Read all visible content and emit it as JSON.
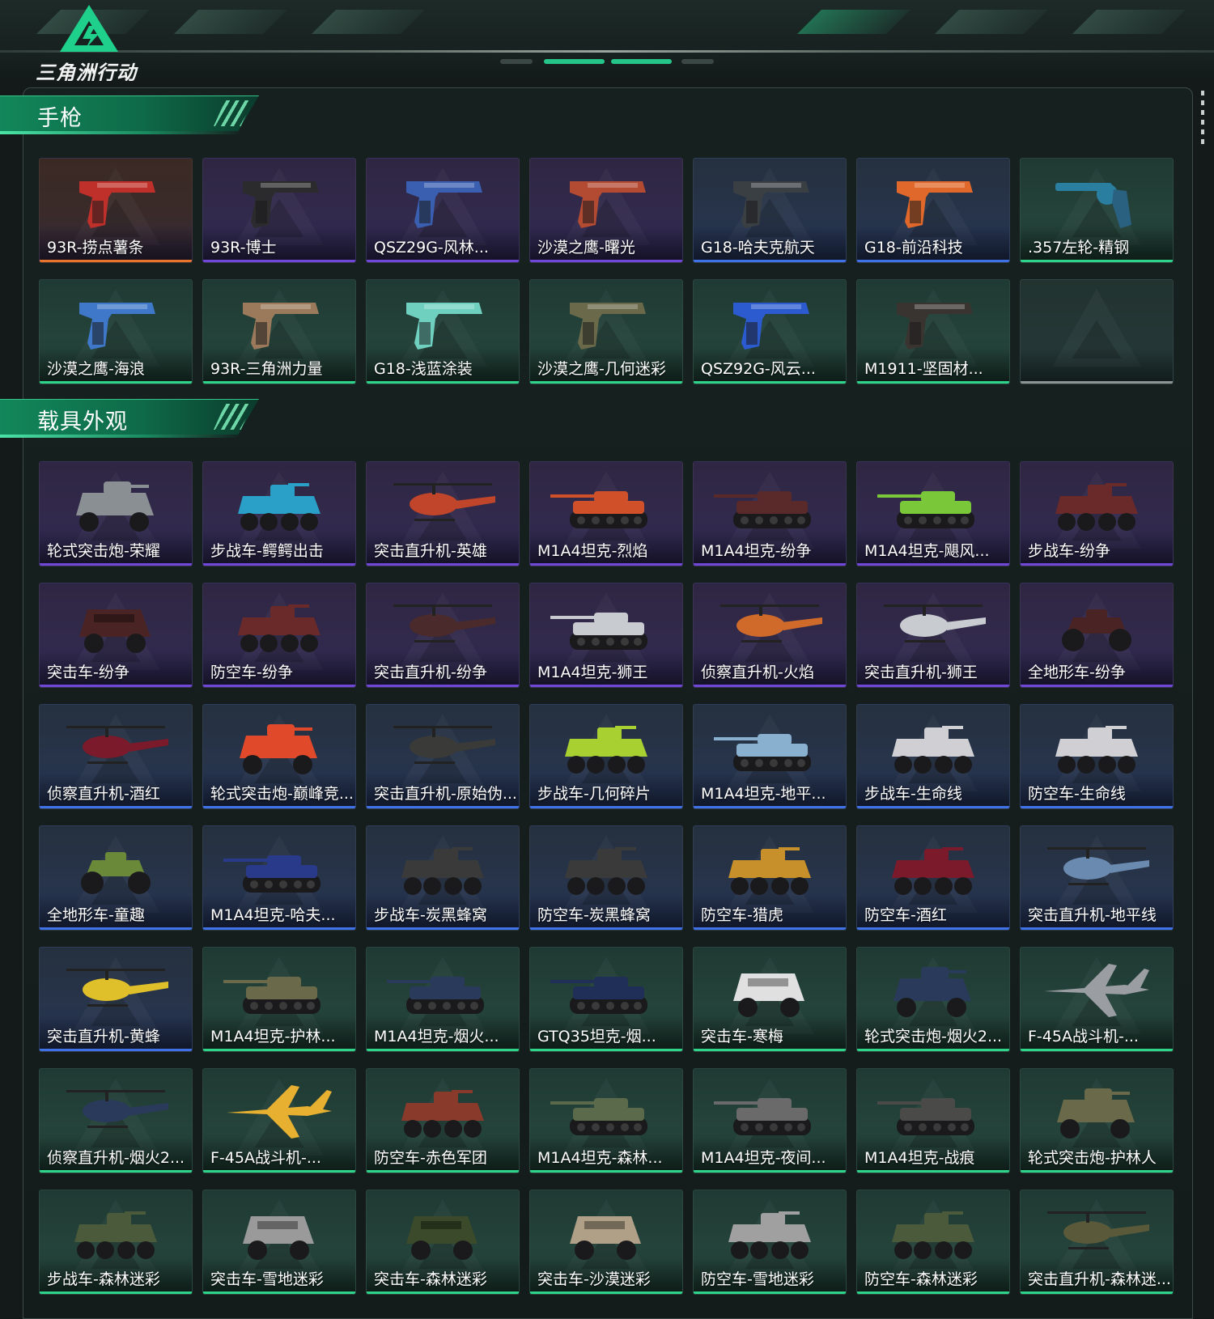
{
  "header": {
    "logo_text": "三角洲行动",
    "accent": "#21d38a"
  },
  "colors": {
    "purple": "#6f48d8",
    "blue": "#3e72e6",
    "green": "#2fd38a",
    "orange": "#e8742e",
    "gray": "#8c9592"
  },
  "sections": [
    {
      "title": "手枪",
      "items": [
        {
          "label": "93R-捞点薯条",
          "rarity": "orange",
          "icon": "pistol-icon",
          "tint": "#c0302a"
        },
        {
          "label": "93R-博士",
          "rarity": "purple",
          "icon": "pistol-icon",
          "tint": "#2b2b2d"
        },
        {
          "label": "QSZ29G-风林...",
          "rarity": "purple",
          "icon": "pistol-icon",
          "tint": "#3a5fb0"
        },
        {
          "label": "沙漠之鹰-曙光",
          "rarity": "purple",
          "icon": "pistol-icon",
          "tint": "#b34a32"
        },
        {
          "label": "G18-哈夫克航天",
          "rarity": "blue",
          "icon": "pistol-icon",
          "tint": "#3a3f44"
        },
        {
          "label": "G18-前沿科技",
          "rarity": "blue",
          "icon": "pistol-icon",
          "tint": "#e0682a"
        },
        {
          "label": ".357左轮-精钢",
          "rarity": "green",
          "icon": "revolver-icon",
          "tint": "#2a7fa0"
        },
        {
          "label": "沙漠之鹰-海浪",
          "rarity": "green",
          "icon": "pistol-icon",
          "tint": "#3f78c8"
        },
        {
          "label": "93R-三角洲力量",
          "rarity": "green",
          "icon": "pistol-icon",
          "tint": "#9a7a5a"
        },
        {
          "label": "G18-浅蓝涂装",
          "rarity": "green",
          "icon": "pistol-icon",
          "tint": "#6fd0c0"
        },
        {
          "label": "沙漠之鹰-几何迷彩",
          "rarity": "green",
          "icon": "pistol-icon",
          "tint": "#6a6a4a"
        },
        {
          "label": "QSZ92G-风云...",
          "rarity": "green",
          "icon": "pistol-icon",
          "tint": "#2c5bd0"
        },
        {
          "label": "M1911-坚固材...",
          "rarity": "green",
          "icon": "pistol-icon",
          "tint": "#3a3430"
        },
        {
          "label": "",
          "rarity": "gray",
          "icon": "empty-slot-icon",
          "tint": ""
        }
      ]
    },
    {
      "title": "载具外观",
      "items": [
        {
          "label": "轮式突击炮-荣耀",
          "rarity": "purple",
          "icon": "armored-car-icon",
          "tint": "#8a8f94"
        },
        {
          "label": "步战车-鳄鳄出击",
          "rarity": "purple",
          "icon": "ifv-icon",
          "tint": "#2aa0c8"
        },
        {
          "label": "突击直升机-英雄",
          "rarity": "purple",
          "icon": "helicopter-icon",
          "tint": "#c0452a"
        },
        {
          "label": "M1A4坦克-烈焰",
          "rarity": "purple",
          "icon": "tank-icon",
          "tint": "#d0502a"
        },
        {
          "label": "M1A4坦克-纷争",
          "rarity": "purple",
          "icon": "tank-icon",
          "tint": "#5a2a2a"
        },
        {
          "label": "M1A4坦克-飓风...",
          "rarity": "purple",
          "icon": "tank-icon",
          "tint": "#7ac83a"
        },
        {
          "label": "步战车-纷争",
          "rarity": "purple",
          "icon": "ifv-icon",
          "tint": "#6a2a2a"
        },
        {
          "label": "突击车-纷争",
          "rarity": "purple",
          "icon": "assault-car-icon",
          "tint": "#4a2424"
        },
        {
          "label": "防空车-纷争",
          "rarity": "purple",
          "icon": "ifv-icon",
          "tint": "#6a2a2a"
        },
        {
          "label": "突击直升机-纷争",
          "rarity": "purple",
          "icon": "helicopter-icon",
          "tint": "#4a2a2a"
        },
        {
          "label": "M1A4坦克-狮王",
          "rarity": "purple",
          "icon": "tank-icon",
          "tint": "#c8ccd0"
        },
        {
          "label": "侦察直升机-火焰",
          "rarity": "purple",
          "icon": "helicopter-icon",
          "tint": "#d06a2a"
        },
        {
          "label": "突击直升机-狮王",
          "rarity": "purple",
          "icon": "helicopter-icon",
          "tint": "#c8ccd0"
        },
        {
          "label": "全地形车-纷争",
          "rarity": "purple",
          "icon": "atv-icon",
          "tint": "#4a2424"
        },
        {
          "label": "侦察直升机-酒红",
          "rarity": "blue",
          "icon": "helicopter-icon",
          "tint": "#7a1a2a"
        },
        {
          "label": "轮式突击炮-巅峰竞...",
          "rarity": "blue",
          "icon": "armored-car-icon",
          "tint": "#e04a2a"
        },
        {
          "label": "突击直升机-原始伪...",
          "rarity": "blue",
          "icon": "helicopter-icon",
          "tint": "#3a3a38"
        },
        {
          "label": "步战车-几何碎片",
          "rarity": "blue",
          "icon": "ifv-icon",
          "tint": "#a8d030"
        },
        {
          "label": "M1A4坦克-地平...",
          "rarity": "blue",
          "icon": "tank-icon",
          "tint": "#8ab0d0"
        },
        {
          "label": "步战车-生命线",
          "rarity": "blue",
          "icon": "ifv-icon",
          "tint": "#d0d0d4"
        },
        {
          "label": "防空车-生命线",
          "rarity": "blue",
          "icon": "ifv-icon",
          "tint": "#d0d0d4"
        },
        {
          "label": "全地形车-童趣",
          "rarity": "blue",
          "icon": "atv-icon",
          "tint": "#6a8a3a"
        },
        {
          "label": "M1A4坦克-哈夫...",
          "rarity": "blue",
          "icon": "tank-icon",
          "tint": "#2a3a8a"
        },
        {
          "label": "步战车-炭黑蜂窝",
          "rarity": "blue",
          "icon": "ifv-icon",
          "tint": "#3a3a3a"
        },
        {
          "label": "防空车-炭黑蜂窝",
          "rarity": "blue",
          "icon": "ifv-icon",
          "tint": "#3a3a3a"
        },
        {
          "label": "防空车-猎虎",
          "rarity": "blue",
          "icon": "ifv-icon",
          "tint": "#c8902a"
        },
        {
          "label": "防空车-酒红",
          "rarity": "blue",
          "icon": "ifv-icon",
          "tint": "#7a1a2a"
        },
        {
          "label": "突击直升机-地平线",
          "rarity": "blue",
          "icon": "helicopter-icon",
          "tint": "#6a8ab0"
        },
        {
          "label": "突击直升机-黄蜂",
          "rarity": "blue",
          "icon": "helicopter-icon",
          "tint": "#e0c02a"
        },
        {
          "label": "M1A4坦克-护林...",
          "rarity": "green",
          "icon": "tank-icon",
          "tint": "#6a6a4a"
        },
        {
          "label": "M1A4坦克-烟火...",
          "rarity": "green",
          "icon": "tank-icon",
          "tint": "#2a3a5a"
        },
        {
          "label": "GTQ35坦克-烟...",
          "rarity": "green",
          "icon": "tank-icon",
          "tint": "#1f2f58"
        },
        {
          "label": "突击车-寒梅",
          "rarity": "green",
          "icon": "assault-car-icon",
          "tint": "#e0e0e0"
        },
        {
          "label": "轮式突击炮-烟火2...",
          "rarity": "green",
          "icon": "armored-car-icon",
          "tint": "#2a3a5a"
        },
        {
          "label": "F-45A战斗机-...",
          "rarity": "green",
          "icon": "jet-icon",
          "tint": "#9a9ea2"
        },
        {
          "label": "侦察直升机-烟火2...",
          "rarity": "green",
          "icon": "helicopter-icon",
          "tint": "#2a3a5a"
        },
        {
          "label": "F-45A战斗机-...",
          "rarity": "green",
          "icon": "jet-icon",
          "tint": "#e8b030"
        },
        {
          "label": "防空车-赤色军团",
          "rarity": "green",
          "icon": "ifv-icon",
          "tint": "#8a3a2a"
        },
        {
          "label": "M1A4坦克-森林...",
          "rarity": "green",
          "icon": "tank-icon",
          "tint": "#5a6a4a"
        },
        {
          "label": "M1A4坦克-夜间...",
          "rarity": "green",
          "icon": "tank-icon",
          "tint": "#6a6a6a"
        },
        {
          "label": "M1A4坦克-战痕",
          "rarity": "green",
          "icon": "tank-icon",
          "tint": "#4a4a48"
        },
        {
          "label": "轮式突击炮-护林人",
          "rarity": "green",
          "icon": "armored-car-icon",
          "tint": "#6a6a4a"
        },
        {
          "label": "步战车-森林迷彩",
          "rarity": "green",
          "icon": "ifv-icon",
          "tint": "#4a5a3a"
        },
        {
          "label": "突击车-雪地迷彩",
          "rarity": "green",
          "icon": "assault-car-icon",
          "tint": "#9a9a9a"
        },
        {
          "label": "突击车-森林迷彩",
          "rarity": "green",
          "icon": "assault-car-icon",
          "tint": "#3a4a2a"
        },
        {
          "label": "突击车-沙漠迷彩",
          "rarity": "green",
          "icon": "assault-car-icon",
          "tint": "#b0a088"
        },
        {
          "label": "防空车-雪地迷彩",
          "rarity": "green",
          "icon": "ifv-icon",
          "tint": "#a0a0a0"
        },
        {
          "label": "防空车-森林迷彩",
          "rarity": "green",
          "icon": "ifv-icon",
          "tint": "#4a5a3a"
        },
        {
          "label": "突击直升机-森林迷...",
          "rarity": "green",
          "icon": "helicopter-icon",
          "tint": "#5a5a3a"
        }
      ]
    }
  ]
}
